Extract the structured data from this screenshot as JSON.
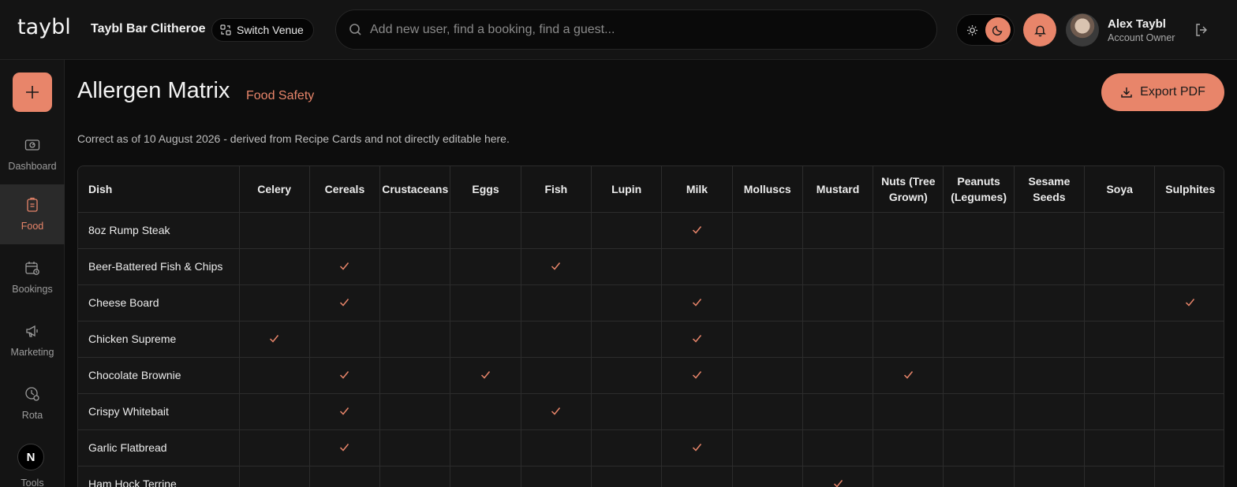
{
  "header": {
    "logo_text": "taybl",
    "venue_name": "Taybl Bar Clitheroe",
    "switch_venue_label": "Switch Venue",
    "search_placeholder": "Add new user, find a booking, find a guest...",
    "user_name": "Alex Taybl",
    "user_role": "Account Owner"
  },
  "sidebar": {
    "items": [
      {
        "label": "Dashboard",
        "icon": "dashboard-icon"
      },
      {
        "label": "Food",
        "icon": "food-icon",
        "active": true
      },
      {
        "label": "Bookings",
        "icon": "bookings-icon"
      },
      {
        "label": "Marketing",
        "icon": "megaphone-icon"
      },
      {
        "label": "Rota",
        "icon": "rota-icon"
      }
    ],
    "badge_letter": "N",
    "tools_label": "Tools"
  },
  "page": {
    "title": "Allergen Matrix",
    "subtitle": "Food Safety",
    "export_label": "Export PDF",
    "note": "Correct as of 10 August 2026 - derived from Recipe Cards and not directly editable here."
  },
  "matrix": {
    "dish_header": "Dish",
    "allergens": [
      "Celery",
      "Cereals",
      "Crustaceans",
      "Eggs",
      "Fish",
      "Lupin",
      "Milk",
      "Molluscs",
      "Mustard",
      "Nuts (Tree Grown)",
      "Peanuts (Legumes)",
      "Sesame Seeds",
      "Soya",
      "Sulphites"
    ],
    "rows": [
      {
        "dish": "8oz Rump Steak",
        "contains": [
          "Milk"
        ]
      },
      {
        "dish": "Beer-Battered Fish & Chips",
        "contains": [
          "Cereals",
          "Fish"
        ]
      },
      {
        "dish": "Cheese Board",
        "contains": [
          "Cereals",
          "Milk",
          "Sulphites"
        ]
      },
      {
        "dish": "Chicken Supreme",
        "contains": [
          "Celery",
          "Milk"
        ]
      },
      {
        "dish": "Chocolate Brownie",
        "contains": [
          "Cereals",
          "Eggs",
          "Milk",
          "Nuts (Tree Grown)"
        ]
      },
      {
        "dish": "Crispy Whitebait",
        "contains": [
          "Cereals",
          "Fish"
        ]
      },
      {
        "dish": "Garlic Flatbread",
        "contains": [
          "Cereals",
          "Milk"
        ]
      },
      {
        "dish": "Ham Hock Terrine",
        "contains": [
          "Mustard"
        ]
      }
    ]
  },
  "colors": {
    "accent": "#e8856a",
    "background": "#0d0d0d",
    "panel": "#141414"
  }
}
